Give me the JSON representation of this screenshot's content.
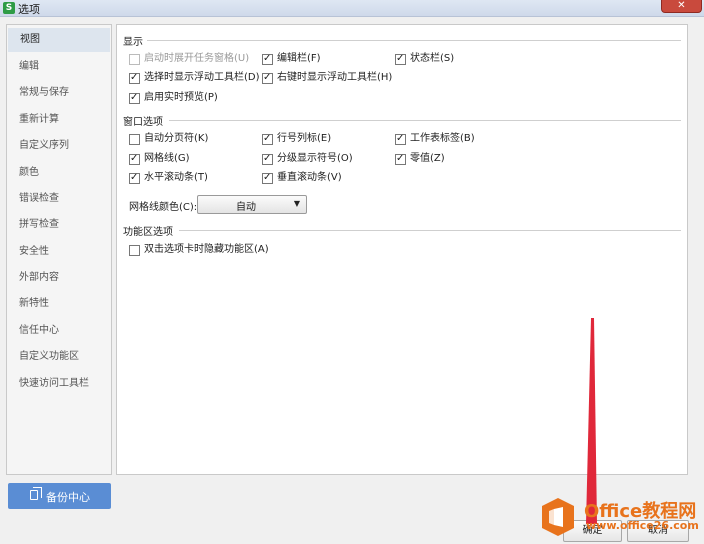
{
  "window": {
    "title": "选项",
    "app_icon": "S",
    "close_icon": "close-icon"
  },
  "sidebar": {
    "items": [
      {
        "label": "视图",
        "selected": true
      },
      {
        "label": "编辑"
      },
      {
        "label": "常规与保存"
      },
      {
        "label": "重新计算"
      },
      {
        "label": "自定义序列"
      },
      {
        "label": "颜色"
      },
      {
        "label": "错误检查"
      },
      {
        "label": "拼写检查"
      },
      {
        "label": "安全性"
      },
      {
        "label": "外部内容"
      },
      {
        "label": "新特性"
      },
      {
        "label": "信任中心"
      },
      {
        "label": "自定义功能区"
      },
      {
        "label": "快速访问工具栏"
      }
    ],
    "backup_label": "备份中心"
  },
  "display": {
    "title": "显示",
    "options": [
      {
        "label": "启动时展开任务窗格(U)",
        "checked": false,
        "disabled": true
      },
      {
        "label": "编辑栏(F)",
        "checked": true
      },
      {
        "label": "状态栏(S)",
        "checked": true
      },
      {
        "label": "选择时显示浮动工具栏(D)",
        "checked": true
      },
      {
        "label": "右键时显示浮动工具栏(H)",
        "checked": true
      },
      {
        "label": "启用实时预览(P)",
        "checked": true
      }
    ]
  },
  "window_options": {
    "title": "窗口选项",
    "options": [
      {
        "label": "自动分页符(K)",
        "checked": false
      },
      {
        "label": "行号列标(E)",
        "checked": true
      },
      {
        "label": "工作表标签(B)",
        "checked": true
      },
      {
        "label": "网格线(G)",
        "checked": true
      },
      {
        "label": "分级显示符号(O)",
        "checked": true
      },
      {
        "label": "零值(Z)",
        "checked": true
      },
      {
        "label": "水平滚动条(T)",
        "checked": true
      },
      {
        "label": "垂直滚动条(V)",
        "checked": true
      }
    ],
    "gridline_color_label": "网格线颜色(C):",
    "gridline_color_value": "自动"
  },
  "ribbon_options": {
    "title": "功能区选项",
    "options": [
      {
        "label": "双击选项卡时隐藏功能区(A)",
        "checked": false
      }
    ]
  },
  "buttons": {
    "ok": "确定",
    "cancel": "取消"
  },
  "watermark": {
    "title": "Office教程网",
    "url": "www.office26.com"
  },
  "colors": {
    "selected_nav": "#dde5ee",
    "backup_button": "#5a8dd4",
    "arrow": "#e0283a",
    "watermark": "#e8731c"
  }
}
